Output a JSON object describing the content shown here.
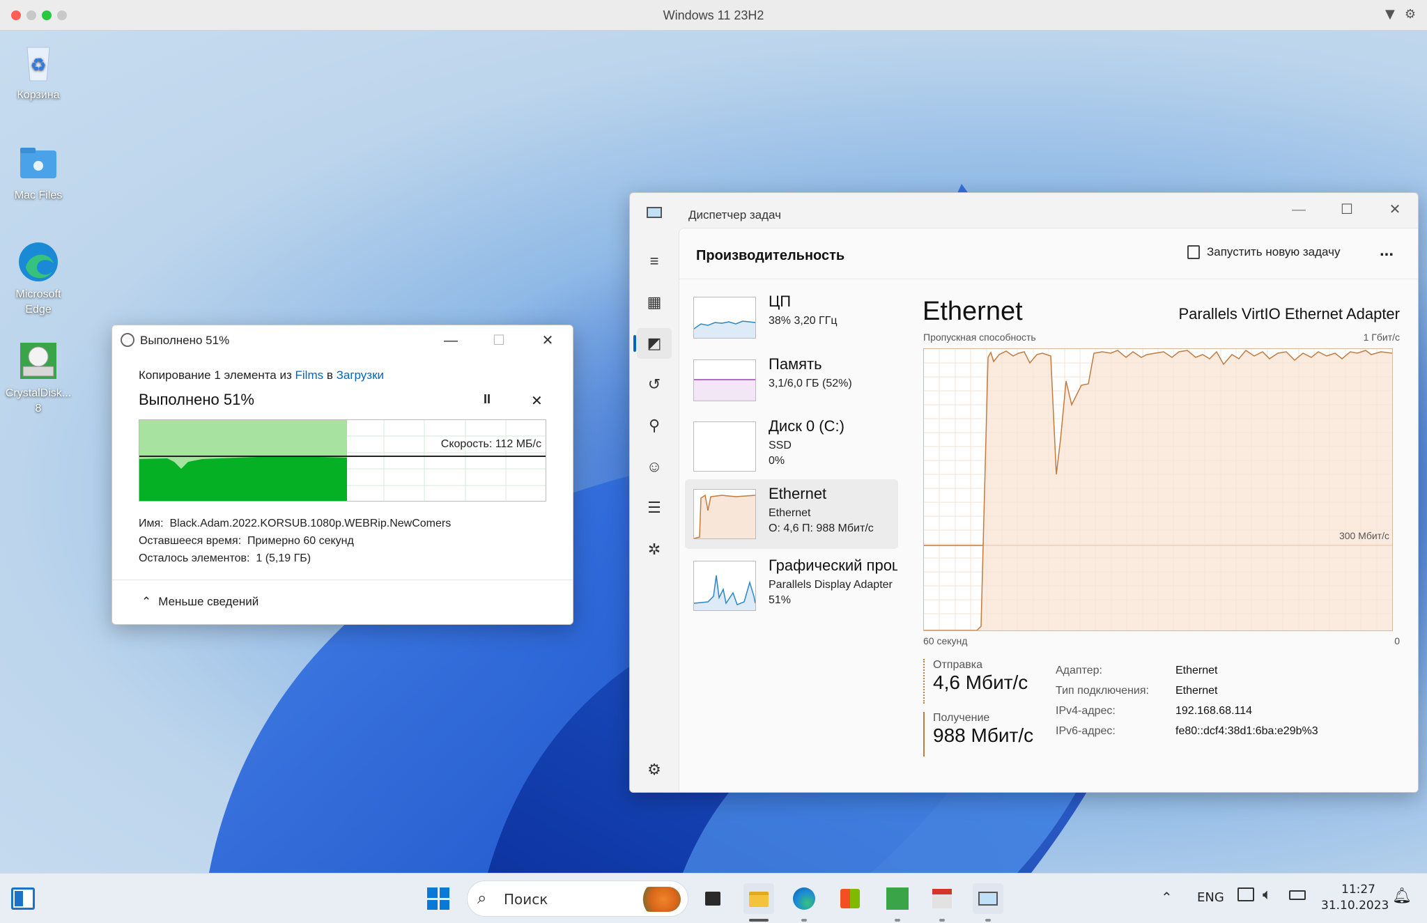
{
  "vm": {
    "title": "Windows 11 23H2"
  },
  "desktop": {
    "icons": [
      {
        "label": "Корзина"
      },
      {
        "label": "Mac Files"
      },
      {
        "label": "Microsoft Edge"
      },
      {
        "label": "CrystalDisk... 8"
      }
    ]
  },
  "copy_dialog": {
    "title": "Выполнено 51%",
    "desc_prefix": "Копирование 1 элемента из ",
    "source": "Films",
    "desc_mid": " в ",
    "dest": "Загрузки",
    "progress_heading": "Выполнено 51%",
    "progress_fraction": 0.51,
    "speed": "Скорость: 112 МБ/с",
    "name_label": "Имя:",
    "name_value": "Black.Adam.2022.KORSUB.1080p.WEBRip.NewComers",
    "time_label": "Оставшееся время:",
    "time_value": "Примерно 60 секунд",
    "items_label": "Осталось элементов:",
    "items_value": "1 (5,19 ГБ)",
    "less_details": "Меньше сведений"
  },
  "task_manager": {
    "title": "Диспетчер задач",
    "page_title": "Производительность",
    "run_task": "Запустить новую задачу",
    "more": "...",
    "list": [
      {
        "name": "ЦП",
        "line2": "38%  3,20 ГГц",
        "line3": ""
      },
      {
        "name": "Память",
        "line2": "3,1/6,0 ГБ (52%)",
        "line3": ""
      },
      {
        "name": "Диск 0 (C:)",
        "line2": "SSD",
        "line3": "0%"
      },
      {
        "name": "Ethernet",
        "line2": "Ethernet",
        "line3": "О: 4,6  П: 988 Мбит/с"
      },
      {
        "name": "Графический процессор",
        "line2": "Parallels Display Adapter",
        "line3": "51%"
      }
    ],
    "detail": {
      "title": "Ethernet",
      "adapter_name": "Parallels VirtIO Ethernet Adapter",
      "throughput_label": "Пропускная способность",
      "max_label": "1 Гбит/с",
      "mid_label": "300 Мбит/с",
      "x_left": "60 секунд",
      "x_right": "0",
      "send_label": "Отправка",
      "send_value": "4,6 Мбит/с",
      "recv_label": "Получение",
      "recv_value": "988 Мбит/с",
      "props": [
        {
          "k": "Адаптер:",
          "v": "Ethernet"
        },
        {
          "k": "Тип подключения:",
          "v": "Ethernet"
        },
        {
          "k": "IPv4-адрес:",
          "v": "192.168.68.114"
        },
        {
          "k": "IPv6-адрес:",
          "v": "fe80::dcf4:38d1:6ba:e29b%3"
        }
      ]
    }
  },
  "taskbar": {
    "search": "Поиск",
    "lang": "ENG",
    "time": "11:27",
    "date": "31.10.2023"
  },
  "colors": {
    "accent": "#0067c0",
    "ethernet": "#c27a3f",
    "copy_green": "#06b025"
  }
}
